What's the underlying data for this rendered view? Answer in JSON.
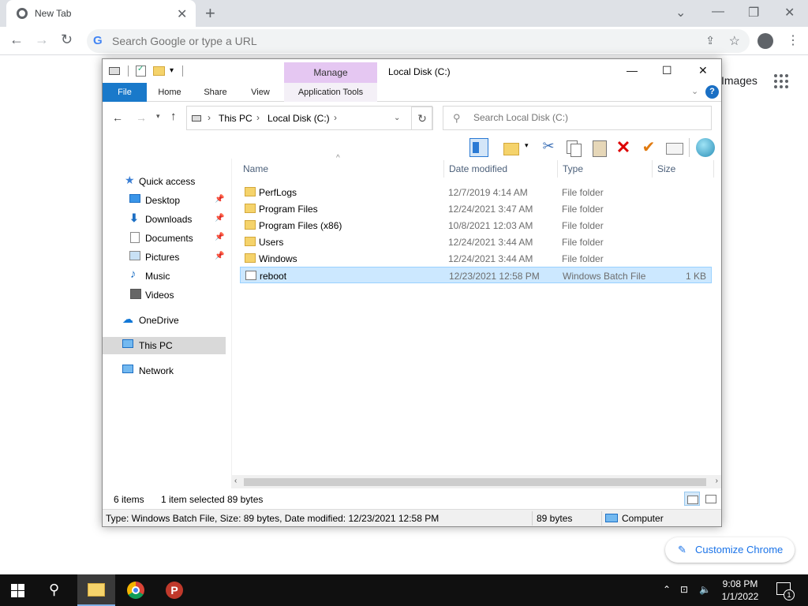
{
  "browser": {
    "tab_title": "New Tab",
    "omnibox_placeholder": "Search Google or type a URL",
    "images_link": "Images",
    "customize_label": "Customize Chrome"
  },
  "explorer": {
    "title": "Local Disk (C:)",
    "manage_label": "Manage",
    "ribbon_tabs": [
      "File",
      "Home",
      "Share",
      "View",
      "Application Tools"
    ],
    "breadcrumb": [
      "This PC",
      "Local Disk (C:)"
    ],
    "search_placeholder": "Search Local Disk (C:)",
    "columns": [
      "Name",
      "Date modified",
      "Type",
      "Size"
    ],
    "nav": {
      "quick_access": "Quick access",
      "desktop": "Desktop",
      "downloads": "Downloads",
      "documents": "Documents",
      "pictures": "Pictures",
      "music": "Music",
      "videos": "Videos",
      "onedrive": "OneDrive",
      "this_pc": "This PC",
      "network": "Network"
    },
    "files": [
      {
        "name": "PerfLogs",
        "date": "12/7/2019 4:14 AM",
        "type": "File folder",
        "size": "",
        "icon": "folder-icon"
      },
      {
        "name": "Program Files",
        "date": "12/24/2021 3:47 AM",
        "type": "File folder",
        "size": "",
        "icon": "folder-icon"
      },
      {
        "name": "Program Files (x86)",
        "date": "10/8/2021 12:03 AM",
        "type": "File folder",
        "size": "",
        "icon": "folder-icon"
      },
      {
        "name": "Users",
        "date": "12/24/2021 3:44 AM",
        "type": "File folder",
        "size": "",
        "icon": "folder-icon"
      },
      {
        "name": "Windows",
        "date": "12/24/2021 3:44 AM",
        "type": "File folder",
        "size": "",
        "icon": "folder-icon"
      },
      {
        "name": "reboot",
        "date": "12/23/2021 12:58 PM",
        "type": "Windows Batch File",
        "size": "1 KB",
        "icon": "batch-file-icon"
      }
    ],
    "status": {
      "item_count": "6 items",
      "selected": "1 item selected",
      "selected_size": "89 bytes"
    },
    "infobar": {
      "details": "Type: Windows Batch File, Size: 89 bytes, Date modified: 12/23/2021 12:58 PM",
      "size": "89 bytes",
      "location": "Computer"
    }
  },
  "taskbar": {
    "time": "9:08 PM",
    "date": "1/1/2022",
    "notification_count": "1"
  },
  "colors": {
    "file_tab": "#1979ca",
    "manage_tab": "#e5c7f2",
    "selection": "#cce8ff",
    "chrome_accent": "#1a73e8"
  }
}
